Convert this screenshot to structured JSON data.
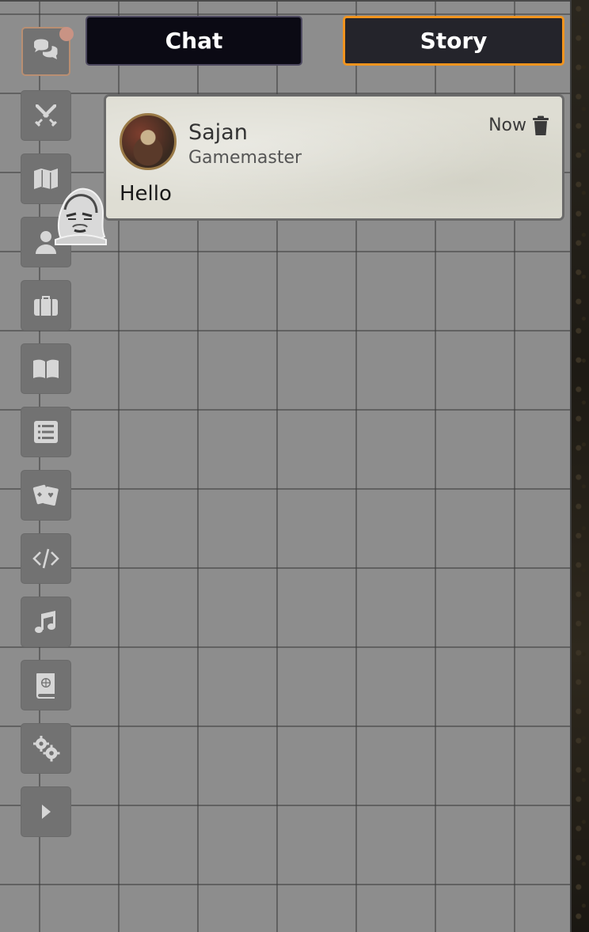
{
  "tabs": {
    "chat_label": "Chat",
    "story_label": "Story"
  },
  "sidebar": {
    "items": [
      {
        "name": "chat",
        "icon": "chat-bubbles-icon",
        "active": true,
        "notification": true
      },
      {
        "name": "combat",
        "icon": "crossed-swords-icon"
      },
      {
        "name": "scenes",
        "icon": "map-icon"
      },
      {
        "name": "actors",
        "icon": "user-icon"
      },
      {
        "name": "items",
        "icon": "suitcase-icon"
      },
      {
        "name": "journal",
        "icon": "open-book-icon"
      },
      {
        "name": "tables",
        "icon": "list-icon"
      },
      {
        "name": "cards",
        "icon": "playing-cards-icon"
      },
      {
        "name": "macros",
        "icon": "code-icon"
      },
      {
        "name": "playlists",
        "icon": "music-note-icon"
      },
      {
        "name": "compendium",
        "icon": "globe-book-icon"
      },
      {
        "name": "settings",
        "icon": "gears-icon"
      },
      {
        "name": "collapse",
        "icon": "caret-right-icon"
      }
    ]
  },
  "message": {
    "sender": "Sajan",
    "role": "Gamemaster",
    "time": "Now",
    "text": "Hello"
  },
  "colors": {
    "story_border": "#f0941f",
    "tab_background": "#0b0a14",
    "notification_dot": "#c99384"
  }
}
